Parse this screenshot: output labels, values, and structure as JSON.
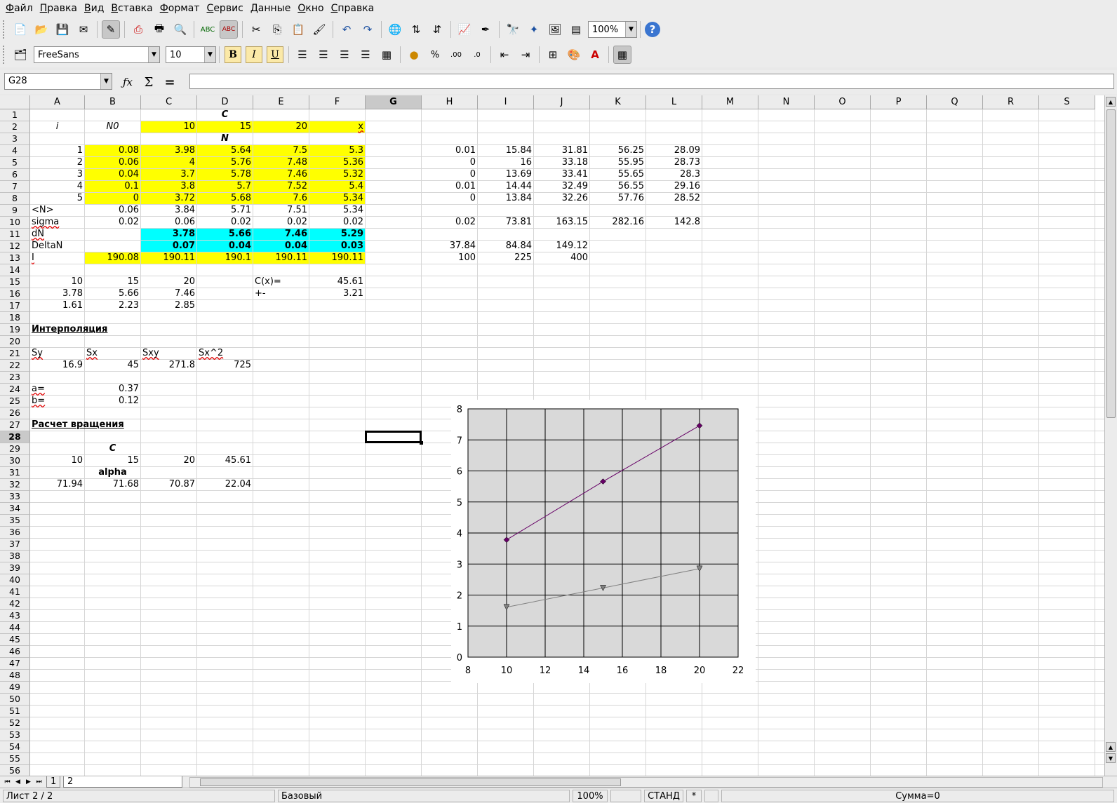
{
  "menu": [
    "Файл",
    "Правка",
    "Вид",
    "Вставка",
    "Формат",
    "Сервис",
    "Данные",
    "Окно",
    "Справка"
  ],
  "toolbar": {
    "zoom": "100%",
    "font_name": "FreeSans",
    "font_size": "10",
    "bold_label": "B",
    "italic_label": "I",
    "underline_label": "U"
  },
  "formula_bar": {
    "cell_ref": "G28",
    "formula_value": ""
  },
  "columns": [
    "A",
    "B",
    "C",
    "D",
    "E",
    "F",
    "G",
    "H",
    "I",
    "J",
    "K",
    "L",
    "M",
    "N",
    "O",
    "P",
    "Q",
    "R",
    "S"
  ],
  "selected_column": "G",
  "selected_row": "28",
  "cells": {
    "C1": "C",
    "A2": "i",
    "B2": "N0",
    "C2": "10",
    "D2": "15",
    "E2": "20",
    "F2": "x",
    "D3": "N",
    "A4": "1",
    "B4": "0.08",
    "C4": "3.98",
    "D4": "5.64",
    "E4": "7.5",
    "F4": "5.3",
    "H4": "0.01",
    "I4": "15.84",
    "J4": "31.81",
    "K4": "56.25",
    "L4": "28.09",
    "A5": "2",
    "B5": "0.06",
    "C5": "4",
    "D5": "5.76",
    "E5": "7.48",
    "F5": "5.36",
    "H5": "0",
    "I5": "16",
    "J5": "33.18",
    "K5": "55.95",
    "L5": "28.73",
    "A6": "3",
    "B6": "0.04",
    "C6": "3.7",
    "D6": "5.78",
    "E6": "7.46",
    "F6": "5.32",
    "H6": "0",
    "I6": "13.69",
    "J6": "33.41",
    "K6": "55.65",
    "L6": "28.3",
    "A7": "4",
    "B7": "0.1",
    "C7": "3.8",
    "D7": "5.7",
    "E7": "7.52",
    "F7": "5.4",
    "H7": "0.01",
    "I7": "14.44",
    "J7": "32.49",
    "K7": "56.55",
    "L7": "29.16",
    "A8": "5",
    "B8": "0",
    "C8": "3.72",
    "D8": "5.68",
    "E8": "7.6",
    "F8": "5.34",
    "H8": "0",
    "I8": "13.84",
    "J8": "32.26",
    "K8": "57.76",
    "L8": "28.52",
    "A9": "<N>",
    "B9": "0.06",
    "C9": "3.84",
    "D9": "5.71",
    "E9": "7.51",
    "F9": "5.34",
    "A10": "sigma",
    "B10": "0.02",
    "C10": "0.06",
    "D10": "0.02",
    "E10": "0.02",
    "F10": "0.02",
    "H10": "0.02",
    "I10": "73.81",
    "J10": "163.15",
    "K10": "282.16",
    "L10": "142.8",
    "A11": "dN",
    "C11": "3.78",
    "D11": "5.66",
    "E11": "7.46",
    "F11": "5.29",
    "A12": "DeltaN",
    "C12": "0.07",
    "D12": "0.04",
    "E12": "0.04",
    "F12": "0.03",
    "H12": "37.84",
    "I12": "84.84",
    "J12": "149.12",
    "A13": "I",
    "B13": "190.08",
    "C13": "190.11",
    "D13": "190.1",
    "E13": "190.11",
    "F13": "190.11",
    "H13": "100",
    "I13": "225",
    "J13": "400",
    "A15": "10",
    "B15": "15",
    "C15": "20",
    "E15": "C(x)=",
    "F15": "45.61",
    "A16": "3.78",
    "B16": "5.66",
    "C16": "7.46",
    "E16": "+-",
    "F16": "3.21",
    "A17": "1.61",
    "B17": "2.23",
    "C17": "2.85",
    "A19": "Интерполяция",
    "A21": "Sy",
    "B21": "Sx",
    "C21": "Sxy",
    "D21": "Sx^2",
    "A22": "16.9",
    "B22": "45",
    "C22": "271.8",
    "D22": "725",
    "A24": "a=",
    "B24": "0.37",
    "A25": "b=",
    "B25": "0.12",
    "A27": "Расчет вращения",
    "B29": "C",
    "A30": "10",
    "B30": "15",
    "C30": "20",
    "D30": "45.61",
    "B31": "alpha",
    "A32": "71.94",
    "B32": "71.68",
    "C32": "70.87",
    "D32": "22.04"
  },
  "chart_data": {
    "type": "scatter",
    "x": [
      10,
      15,
      20
    ],
    "series": [
      {
        "values": [
          3.78,
          5.66,
          7.46
        ],
        "color": "#660066",
        "marker": "diamond"
      },
      {
        "values": [
          1.61,
          2.23,
          2.85
        ],
        "color": "#808080",
        "marker": "triangle-down"
      }
    ],
    "xlim": [
      8,
      22
    ],
    "ylim": [
      0,
      8
    ],
    "xticks": [
      "8",
      "10",
      "12",
      "14",
      "16",
      "18",
      "20",
      "22"
    ],
    "yticks": [
      "0",
      "1",
      "2",
      "3",
      "4",
      "5",
      "6",
      "7",
      "8"
    ],
    "grid": true,
    "plot_background": "#d9d9d9",
    "title": "",
    "xlabel": "",
    "ylabel": ""
  },
  "sheet_tabs": [
    "1",
    "2"
  ],
  "active_sheet": "2",
  "status": {
    "sheet": "Лист 2 / 2",
    "style": "Базовый",
    "zoom": "100%",
    "mode": "СТАНД",
    "modified": "*",
    "sum": "Сумма=0"
  }
}
